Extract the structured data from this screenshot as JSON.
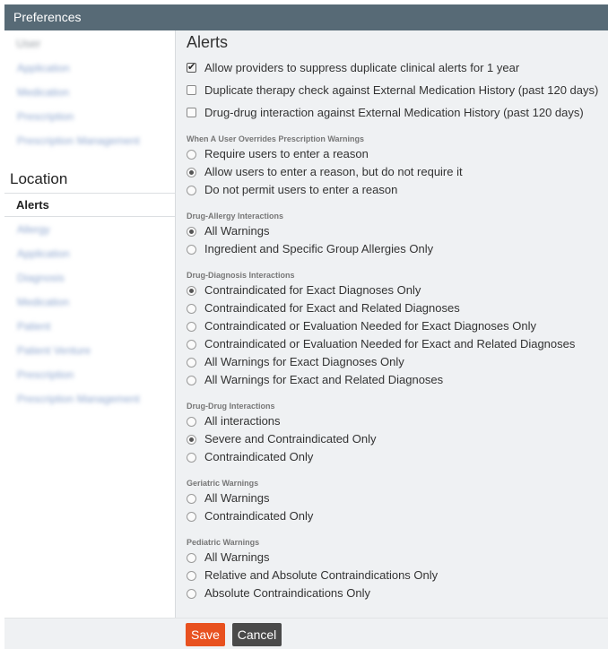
{
  "window": {
    "title": "Preferences"
  },
  "sidebar": {
    "user_group": {
      "title": "User",
      "items": [
        "Application",
        "Medication",
        "Prescription",
        "Prescription Management"
      ]
    },
    "location_heading": "Location",
    "active_item": "Alerts",
    "location_items": [
      "Allergy",
      "Application",
      "Diagnosis",
      "Medication",
      "Patient",
      "Patient Venture",
      "Prescription",
      "Prescription Management"
    ]
  },
  "alerts": {
    "title": "Alerts",
    "options": [
      {
        "label": "Allow providers to suppress duplicate clinical alerts for 1 year",
        "checked": true
      },
      {
        "label": "Duplicate therapy check against External Medication History (past 120 days)",
        "checked": false
      },
      {
        "label": "Drug-drug interaction against External Medication History (past 120 days)",
        "checked": false
      }
    ]
  },
  "sections": [
    {
      "title": "When A User Overrides Prescription Warnings",
      "options": [
        "Require users to enter a reason",
        "Allow users to enter a reason, but do not require it",
        "Do not permit users to enter a reason"
      ],
      "selected": 1
    },
    {
      "title": "Drug-Allergy Interactions",
      "options": [
        "All Warnings",
        "Ingredient and Specific Group Allergies Only"
      ],
      "selected": 0
    },
    {
      "title": "Drug-Diagnosis Interactions",
      "options": [
        "Contraindicated for Exact Diagnoses Only",
        "Contraindicated for Exact and Related Diagnoses",
        "Contraindicated or Evaluation Needed for Exact Diagnoses Only",
        "Contraindicated or Evaluation Needed for Exact and Related Diagnoses",
        "All Warnings for Exact Diagnoses Only",
        "All Warnings for Exact and Related Diagnoses"
      ],
      "selected": 0
    },
    {
      "title": "Drug-Drug Interactions",
      "options": [
        "All interactions",
        "Severe and Contraindicated Only",
        "Contraindicated Only"
      ],
      "selected": 1
    },
    {
      "title": "Geriatric Warnings",
      "options": [
        "All Warnings",
        "Contraindicated Only"
      ],
      "selected": null
    },
    {
      "title": "Pediatric Warnings",
      "options": [
        "All Warnings",
        "Relative and Absolute Contraindications Only",
        "Absolute Contraindications Only"
      ],
      "selected": null
    }
  ],
  "footer": {
    "save_label": "Save",
    "cancel_label": "Cancel"
  },
  "colors": {
    "titlebar": "#576a76",
    "panel": "#eff1f3",
    "save": "#e8511f",
    "cancel": "#4a4a4a"
  }
}
